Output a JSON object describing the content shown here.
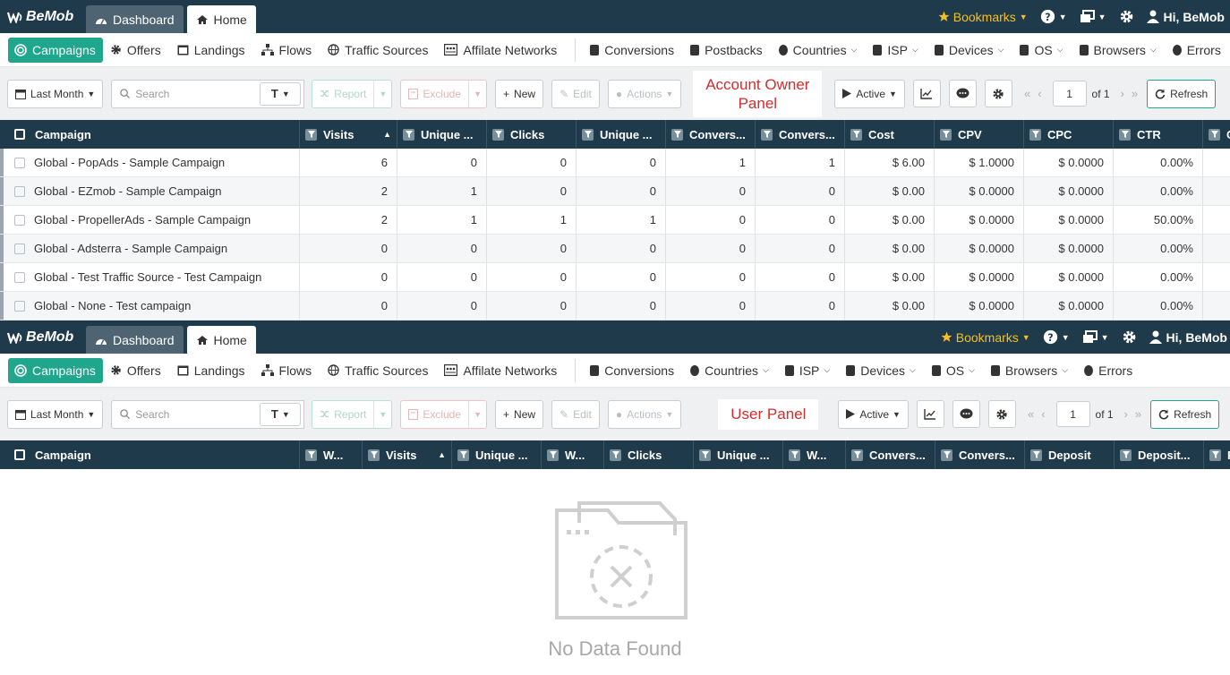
{
  "brand": "BeMob",
  "colors": {
    "topbar": "#1f3a4b",
    "accent": "#1fa68d",
    "bookmarks": "#f5c026",
    "label": "#d62b2b"
  },
  "top_tabs": [
    "Dashboard",
    "Home"
  ],
  "top_right": {
    "bookmarks": "Bookmarks",
    "greeting": "Hi, BeMob"
  },
  "owner": {
    "nav": [
      {
        "label": "Campaigns",
        "icon": "campaigns-icon"
      },
      {
        "label": "Offers",
        "icon": "gear-icon"
      },
      {
        "label": "Landings",
        "icon": "landing-icon"
      },
      {
        "label": "Flows",
        "icon": "sitemap-icon"
      },
      {
        "label": "Traffic Sources",
        "icon": "globe-icon"
      },
      {
        "label": "Affilate Networks",
        "icon": "network-icon"
      }
    ],
    "nav_right": [
      {
        "label": "Conversions",
        "icon": "dollar-icon",
        "dd": false
      },
      {
        "label": "Postbacks",
        "icon": "download-icon",
        "dd": false
      },
      {
        "label": "Countries",
        "icon": "flag-icon",
        "dd": true
      },
      {
        "label": "ISP",
        "icon": "wifi-icon",
        "dd": true
      },
      {
        "label": "Devices",
        "icon": "laptop-icon",
        "dd": true
      },
      {
        "label": "OS",
        "icon": "mobile-icon",
        "dd": true
      },
      {
        "label": "Browsers",
        "icon": "browser-icon",
        "dd": true
      },
      {
        "label": "Errors",
        "icon": "error-icon",
        "dd": false
      }
    ],
    "toolbar": {
      "period": "Last Month",
      "search_placeholder": "Search",
      "search_type": "T",
      "report": "Report",
      "exclude": "Exclude",
      "new": "New",
      "edit": "Edit",
      "actions": "Actions",
      "label_line1": "Account Owner",
      "label_line2": "Panel",
      "status": "Active",
      "page": "1",
      "of": "of 1",
      "refresh": "Refresh"
    },
    "columns": [
      "Visits",
      "Unique ...",
      "Clicks",
      "Unique ...",
      "Convers...",
      "Convers...",
      "Cost",
      "CPV",
      "CPC",
      "CTR",
      "C"
    ],
    "header_first": "Campaign",
    "rows": [
      {
        "name": "Global - PopAds - Sample Campaign",
        "cells": [
          "6",
          "0",
          "0",
          "0",
          "1",
          "1",
          "$ 6.00",
          "$ 1.0000",
          "$ 0.0000",
          "0.00%"
        ]
      },
      {
        "name": "Global - EZmob - Sample Campaign",
        "cells": [
          "2",
          "1",
          "0",
          "0",
          "0",
          "0",
          "$ 0.00",
          "$ 0.0000",
          "$ 0.0000",
          "0.00%"
        ]
      },
      {
        "name": "Global - PropellerAds - Sample Campaign",
        "cells": [
          "2",
          "1",
          "1",
          "1",
          "0",
          "0",
          "$ 0.00",
          "$ 0.0000",
          "$ 0.0000",
          "50.00%"
        ]
      },
      {
        "name": "Global - Adsterra - Sample Campaign",
        "cells": [
          "0",
          "0",
          "0",
          "0",
          "0",
          "0",
          "$ 0.00",
          "$ 0.0000",
          "$ 0.0000",
          "0.00%"
        ]
      },
      {
        "name": "Global - Test Traffic Source - Test Campaign",
        "cells": [
          "0",
          "0",
          "0",
          "0",
          "0",
          "0",
          "$ 0.00",
          "$ 0.0000",
          "$ 0.0000",
          "0.00%"
        ]
      },
      {
        "name": "Global - None - Test campaign",
        "cells": [
          "0",
          "0",
          "0",
          "0",
          "0",
          "0",
          "$ 0.00",
          "$ 0.0000",
          "$ 0.0000",
          "0.00%"
        ]
      }
    ]
  },
  "user": {
    "nav_right": [
      {
        "label": "Conversions",
        "icon": "dollar-icon",
        "dd": false
      },
      {
        "label": "Countries",
        "icon": "flag-icon",
        "dd": true
      },
      {
        "label": "ISP",
        "icon": "wifi-icon",
        "dd": true
      },
      {
        "label": "Devices",
        "icon": "laptop-icon",
        "dd": true
      },
      {
        "label": "OS",
        "icon": "mobile-icon",
        "dd": true
      },
      {
        "label": "Browsers",
        "icon": "browser-icon",
        "dd": true
      },
      {
        "label": "Errors",
        "icon": "error-icon",
        "dd": false
      }
    ],
    "label": "User Panel",
    "columns": [
      "W...",
      "Visits",
      "Unique ...",
      "W...",
      "Clicks",
      "Unique ...",
      "W...",
      "Convers...",
      "Convers...",
      "Deposit",
      "Deposit...",
      "R"
    ],
    "empty": "No Data Found"
  }
}
